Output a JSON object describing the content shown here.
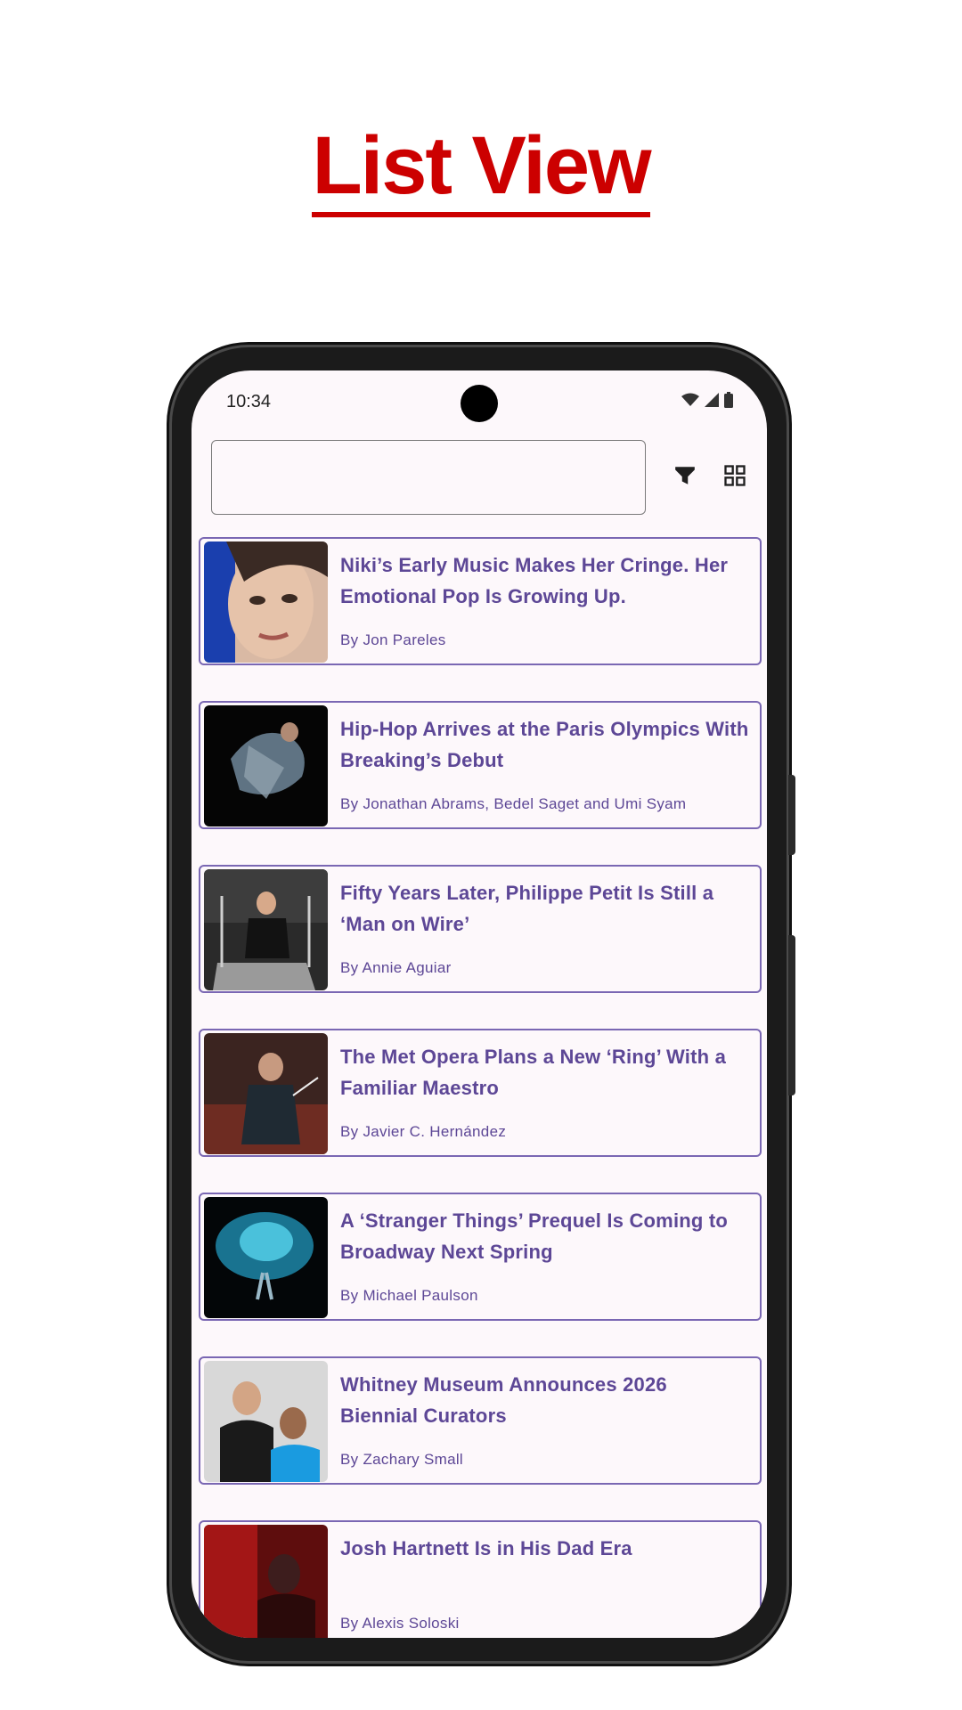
{
  "headline": "List View",
  "status_bar": {
    "time": "10:34",
    "icons": [
      "wifi-icon",
      "signal-icon",
      "battery-icon"
    ]
  },
  "toolbar": {
    "search_value": "",
    "search_placeholder": "",
    "filter_icon": "filter-icon",
    "grid_icon": "grid-view-icon"
  },
  "articles": [
    {
      "title": "Niki’s Early Music Makes Her Cringe. Her Emotional Pop Is Growing Up.",
      "author": "By Jon Pareles"
    },
    {
      "title": "Hip-Hop Arrives at the Paris Olympics With Breaking’s Debut",
      "author": "By Jonathan Abrams, Bedel Saget and Umi Syam"
    },
    {
      "title": "Fifty Years Later, Philippe Petit Is Still a ‘Man on Wire’",
      "author": "By Annie Aguiar"
    },
    {
      "title": "The Met Opera Plans a New ‘Ring’ With a Familiar Maestro",
      "author": "By Javier C. Hernández"
    },
    {
      "title": "A ‘Stranger Things’ Prequel Is Coming to Broadway Next Spring",
      "author": "By Michael Paulson"
    },
    {
      "title": "Whitney Museum Announces 2026 Biennial Curators",
      "author": "By Zachary Small"
    },
    {
      "title": "Josh Hartnett Is in His Dad Era",
      "author": "By Alexis Soloski"
    }
  ],
  "colors": {
    "headline": "#cc0000",
    "accent": "#5d4796",
    "card_border": "#7a67b3",
    "screen_bg": "#fdf8fb"
  }
}
